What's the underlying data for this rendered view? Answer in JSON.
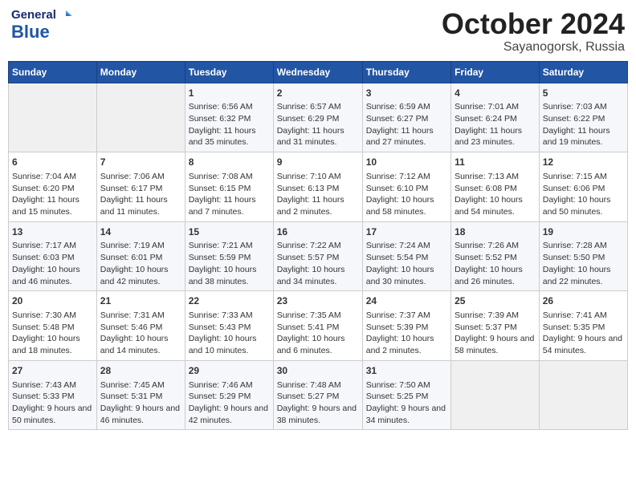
{
  "header": {
    "logo_general": "General",
    "logo_blue": "Blue",
    "month": "October 2024",
    "location": "Sayanogorsk, Russia"
  },
  "weekdays": [
    "Sunday",
    "Monday",
    "Tuesday",
    "Wednesday",
    "Thursday",
    "Friday",
    "Saturday"
  ],
  "weeks": [
    [
      {
        "day": "",
        "info": ""
      },
      {
        "day": "",
        "info": ""
      },
      {
        "day": "1",
        "info": "Sunrise: 6:56 AM\nSunset: 6:32 PM\nDaylight: 11 hours and 35 minutes."
      },
      {
        "day": "2",
        "info": "Sunrise: 6:57 AM\nSunset: 6:29 PM\nDaylight: 11 hours and 31 minutes."
      },
      {
        "day": "3",
        "info": "Sunrise: 6:59 AM\nSunset: 6:27 PM\nDaylight: 11 hours and 27 minutes."
      },
      {
        "day": "4",
        "info": "Sunrise: 7:01 AM\nSunset: 6:24 PM\nDaylight: 11 hours and 23 minutes."
      },
      {
        "day": "5",
        "info": "Sunrise: 7:03 AM\nSunset: 6:22 PM\nDaylight: 11 hours and 19 minutes."
      }
    ],
    [
      {
        "day": "6",
        "info": "Sunrise: 7:04 AM\nSunset: 6:20 PM\nDaylight: 11 hours and 15 minutes."
      },
      {
        "day": "7",
        "info": "Sunrise: 7:06 AM\nSunset: 6:17 PM\nDaylight: 11 hours and 11 minutes."
      },
      {
        "day": "8",
        "info": "Sunrise: 7:08 AM\nSunset: 6:15 PM\nDaylight: 11 hours and 7 minutes."
      },
      {
        "day": "9",
        "info": "Sunrise: 7:10 AM\nSunset: 6:13 PM\nDaylight: 11 hours and 2 minutes."
      },
      {
        "day": "10",
        "info": "Sunrise: 7:12 AM\nSunset: 6:10 PM\nDaylight: 10 hours and 58 minutes."
      },
      {
        "day": "11",
        "info": "Sunrise: 7:13 AM\nSunset: 6:08 PM\nDaylight: 10 hours and 54 minutes."
      },
      {
        "day": "12",
        "info": "Sunrise: 7:15 AM\nSunset: 6:06 PM\nDaylight: 10 hours and 50 minutes."
      }
    ],
    [
      {
        "day": "13",
        "info": "Sunrise: 7:17 AM\nSunset: 6:03 PM\nDaylight: 10 hours and 46 minutes."
      },
      {
        "day": "14",
        "info": "Sunrise: 7:19 AM\nSunset: 6:01 PM\nDaylight: 10 hours and 42 minutes."
      },
      {
        "day": "15",
        "info": "Sunrise: 7:21 AM\nSunset: 5:59 PM\nDaylight: 10 hours and 38 minutes."
      },
      {
        "day": "16",
        "info": "Sunrise: 7:22 AM\nSunset: 5:57 PM\nDaylight: 10 hours and 34 minutes."
      },
      {
        "day": "17",
        "info": "Sunrise: 7:24 AM\nSunset: 5:54 PM\nDaylight: 10 hours and 30 minutes."
      },
      {
        "day": "18",
        "info": "Sunrise: 7:26 AM\nSunset: 5:52 PM\nDaylight: 10 hours and 26 minutes."
      },
      {
        "day": "19",
        "info": "Sunrise: 7:28 AM\nSunset: 5:50 PM\nDaylight: 10 hours and 22 minutes."
      }
    ],
    [
      {
        "day": "20",
        "info": "Sunrise: 7:30 AM\nSunset: 5:48 PM\nDaylight: 10 hours and 18 minutes."
      },
      {
        "day": "21",
        "info": "Sunrise: 7:31 AM\nSunset: 5:46 PM\nDaylight: 10 hours and 14 minutes."
      },
      {
        "day": "22",
        "info": "Sunrise: 7:33 AM\nSunset: 5:43 PM\nDaylight: 10 hours and 10 minutes."
      },
      {
        "day": "23",
        "info": "Sunrise: 7:35 AM\nSunset: 5:41 PM\nDaylight: 10 hours and 6 minutes."
      },
      {
        "day": "24",
        "info": "Sunrise: 7:37 AM\nSunset: 5:39 PM\nDaylight: 10 hours and 2 minutes."
      },
      {
        "day": "25",
        "info": "Sunrise: 7:39 AM\nSunset: 5:37 PM\nDaylight: 9 hours and 58 minutes."
      },
      {
        "day": "26",
        "info": "Sunrise: 7:41 AM\nSunset: 5:35 PM\nDaylight: 9 hours and 54 minutes."
      }
    ],
    [
      {
        "day": "27",
        "info": "Sunrise: 7:43 AM\nSunset: 5:33 PM\nDaylight: 9 hours and 50 minutes."
      },
      {
        "day": "28",
        "info": "Sunrise: 7:45 AM\nSunset: 5:31 PM\nDaylight: 9 hours and 46 minutes."
      },
      {
        "day": "29",
        "info": "Sunrise: 7:46 AM\nSunset: 5:29 PM\nDaylight: 9 hours and 42 minutes."
      },
      {
        "day": "30",
        "info": "Sunrise: 7:48 AM\nSunset: 5:27 PM\nDaylight: 9 hours and 38 minutes."
      },
      {
        "day": "31",
        "info": "Sunrise: 7:50 AM\nSunset: 5:25 PM\nDaylight: 9 hours and 34 minutes."
      },
      {
        "day": "",
        "info": ""
      },
      {
        "day": "",
        "info": ""
      }
    ]
  ]
}
